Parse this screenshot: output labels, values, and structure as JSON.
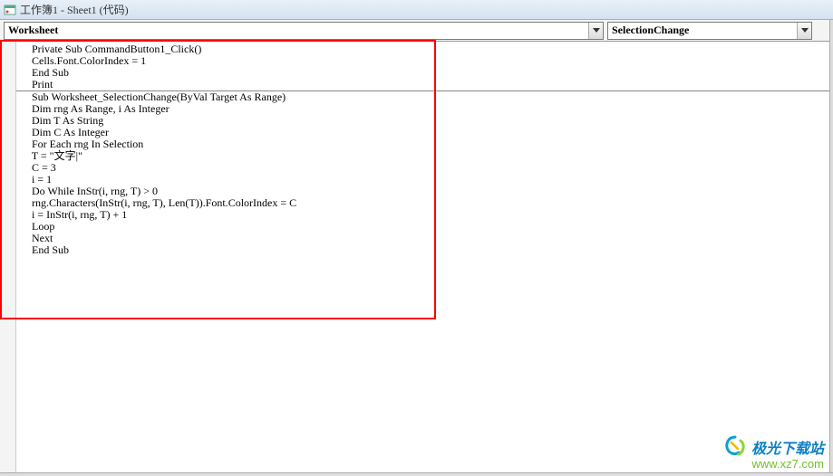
{
  "window": {
    "title": "工作簿1 - Sheet1 (代码)"
  },
  "dropdowns": {
    "object": "Worksheet",
    "procedure": "SelectionChange"
  },
  "code": {
    "block1": {
      "l1": "   Private Sub CommandButton1_Click()",
      "l2": "   Cells.Font.ColorIndex = 1",
      "l3": "   End Sub",
      "l4": "   Print"
    },
    "block2": {
      "l1": "   Sub Worksheet_SelectionChange(ByVal Target As Range)",
      "l2": "   Dim rng As Range, i As Integer",
      "l3": "   Dim T As String",
      "l4": "   Dim C As Integer",
      "l5": "   For Each rng In Selection",
      "l6": "   T = \"文字|\"",
      "l7": "   C = 3",
      "l8": "   i = 1",
      "l9": "   Do While InStr(i, rng, T) > 0",
      "l10": "   rng.Characters(InStr(i, rng, T), Len(T)).Font.ColorIndex = C",
      "l11": "   i = InStr(i, rng, T) + 1",
      "l12": "   Loop",
      "l13": "   Next",
      "l14": "   End Sub"
    }
  },
  "watermark": {
    "name": "极光下载站",
    "url": "www.xz7.com"
  }
}
